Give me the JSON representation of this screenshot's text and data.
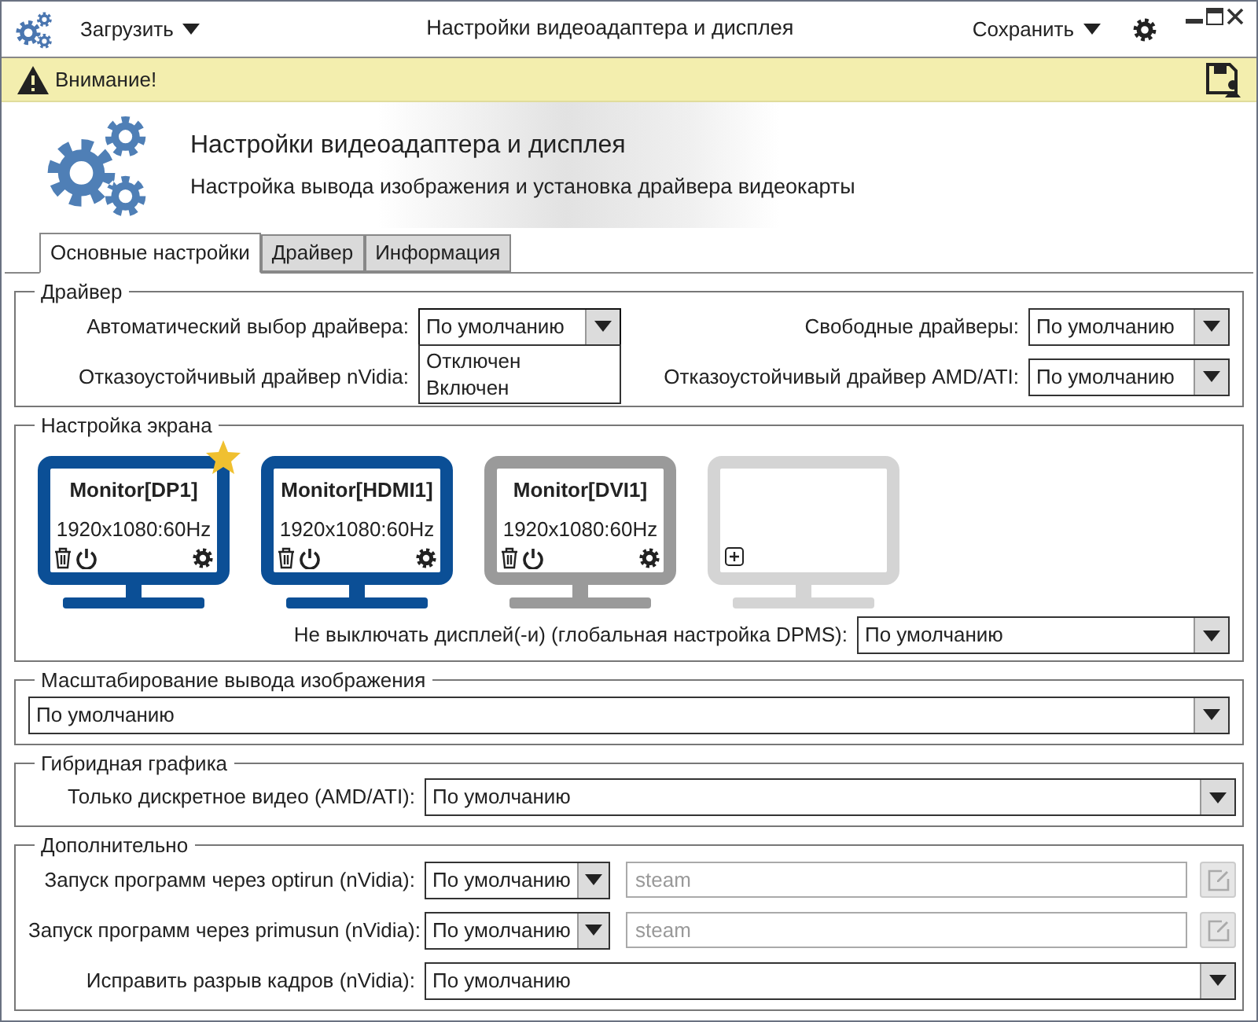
{
  "window": {
    "title": "Настройки видеоадаптера и дисплея",
    "load_menu": "Загрузить",
    "save_menu": "Сохранить"
  },
  "warning": {
    "text": "Внимание!"
  },
  "header": {
    "title": "Настройки видеоадаптера и дисплея",
    "subtitle": "Настройка вывода изображения и установка драйвера видеокарты"
  },
  "tabs": [
    {
      "label": "Основные настройки",
      "selected": true
    },
    {
      "label": "Драйвер",
      "selected": false
    },
    {
      "label": "Информация",
      "selected": false
    }
  ],
  "driver_group": {
    "title": "Драйвер",
    "left_fields": [
      {
        "label": "Автоматический выбор драйвера:",
        "value": "По умолчанию",
        "expanded": true,
        "options": [
          "Отключен",
          "Включен"
        ]
      },
      {
        "label": "Отказоустойчивый драйвер nVidia:"
      }
    ],
    "right_fields": [
      {
        "label": "Свободные драйверы:",
        "value": "По умолчанию"
      },
      {
        "label": "Отказоустойчивый драйвер AMD/ATI:",
        "value": "По умолчанию"
      }
    ]
  },
  "screen_group": {
    "title": "Настройка экрана",
    "monitors": [
      {
        "kind": "active",
        "name": "Monitor[DP1]",
        "mode": "1920x1080:60Hz",
        "primary": true
      },
      {
        "kind": "active",
        "name": "Monitor[HDMI1]",
        "mode": "1920x1080:60Hz",
        "primary": false
      },
      {
        "kind": "disabled",
        "name": "Monitor[DVI1]",
        "mode": "1920x1080:60Hz",
        "primary": false
      },
      {
        "kind": "empty"
      }
    ],
    "dpms_label": "Не выключать дисплей(-и) (глобальная настройка DPMS):",
    "dpms_value": "По умолчанию"
  },
  "scaling_group": {
    "title": "Масштабирование вывода изображения",
    "value": "По умолчанию"
  },
  "hybrid_group": {
    "title": "Гибридная графика",
    "label": "Только дискретное видео (AMD/ATI):",
    "value": "По умолчанию"
  },
  "extra_group": {
    "title": "Дополнительно",
    "rows": [
      {
        "kind": "select_entry",
        "label": "Запуск программ через optirun (nVidia):",
        "value": "По умолчанию",
        "placeholder": "steam"
      },
      {
        "kind": "select_entry",
        "label": "Запуск программ через primusun (nVidia):",
        "value": "По умолчанию",
        "placeholder": "steam"
      },
      {
        "kind": "select",
        "label": "Исправить разрыв кадров (nVidia):",
        "value": "По умолчанию"
      }
    ]
  }
}
